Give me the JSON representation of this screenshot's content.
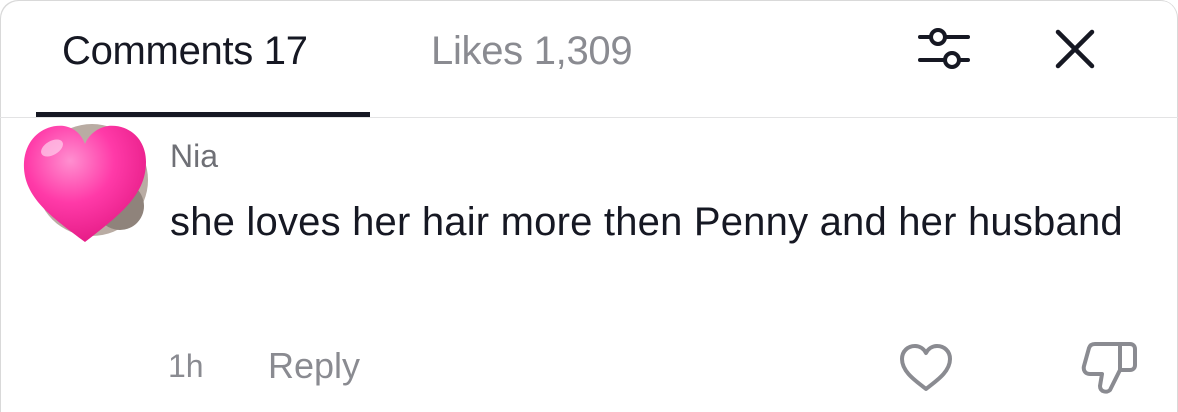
{
  "header": {
    "tabs": [
      {
        "label": "Comments 17",
        "active": true
      },
      {
        "label": "Likes 1,309",
        "active": false
      }
    ],
    "icons": {
      "filter": "sliders-filter-icon",
      "close": "close-icon"
    }
  },
  "comment": {
    "avatar": "pink-heart-avatar",
    "username": "Nia",
    "text": "she loves her hair more then Penny and her husband",
    "timestamp": "1h",
    "reply_label": "Reply",
    "icons": {
      "like": "heart-outline-icon",
      "dislike": "thumbs-down-icon"
    }
  },
  "colors": {
    "primary_text": "#161823",
    "secondary_text": "#8a8b91",
    "avatar_heart": "#ff3aa8"
  }
}
